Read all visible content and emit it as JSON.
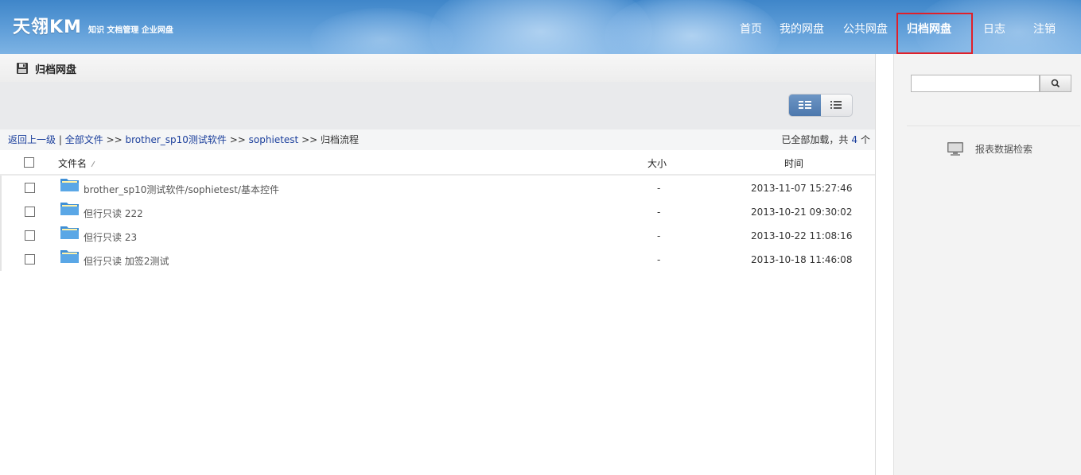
{
  "header": {
    "logo_mark": "天翎KM",
    "logo_tagline": "知识 文档管理 企业网盘",
    "nav": [
      {
        "label": "首页",
        "active": false
      },
      {
        "label": "我的网盘",
        "active": false
      },
      {
        "label": "公共网盘",
        "active": false
      },
      {
        "label": "归档网盘",
        "active": true
      },
      {
        "label": "日志",
        "active": false
      },
      {
        "label": "注销",
        "active": false
      }
    ],
    "highlight_color": "#e0202a"
  },
  "page": {
    "title": "归档网盘",
    "title_icon": "floppy-disk-icon"
  },
  "toolbar": {
    "view_modes": [
      "grid-view-icon",
      "list-view-icon"
    ],
    "active_view": "grid-view-icon"
  },
  "breadcrumb": {
    "back": "返回上一级",
    "divider": "|",
    "items": [
      "全部文件",
      "brother_sp10测试软件",
      "sophietest"
    ],
    "separator": ">>",
    "current": "归档流程",
    "status_prefix": "已全部加载，共",
    "count": "4",
    "status_suffix": "个"
  },
  "table": {
    "columns": {
      "name": "文件名",
      "sort_icon": "sort-icon",
      "size": "大小",
      "time": "时间"
    },
    "rows": [
      {
        "name": "brother_sp10测试软件/sophietest/基本控件",
        "size": "-",
        "time": "2013-11-07 15:27:46"
      },
      {
        "name": "但行只读 222",
        "size": "-",
        "time": "2013-10-21 09:30:02"
      },
      {
        "name": "但行只读 23",
        "size": "-",
        "time": "2013-10-22 11:08:16"
      },
      {
        "name": "但行只读 加签2测试",
        "size": "-",
        "time": "2013-10-18 11:46:08"
      }
    ]
  },
  "sidebar": {
    "search": {
      "value": "",
      "placeholder": ""
    },
    "report_label": "报表数据检索"
  },
  "colors": {
    "header_blue": "#4f90d1",
    "link_blue": "#1b3f9c",
    "active_view_blue": "#4d78ad"
  }
}
